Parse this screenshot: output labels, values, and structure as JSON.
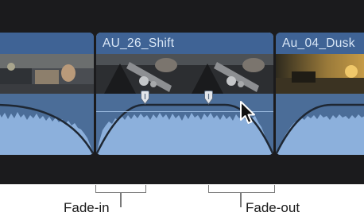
{
  "timeline": {
    "clips": [
      {
        "title": ""
      },
      {
        "title": "AU_26_Shift"
      },
      {
        "title": "Au_04_Dusk"
      }
    ]
  },
  "callouts": {
    "fade_in": "Fade-in",
    "fade_out": "Fade-out"
  },
  "icons": [
    "fade-handle-icon",
    "pointer-cursor-icon"
  ],
  "colors": {
    "timeline_bg": "#1b1b1d",
    "clip_header": "#3f6395",
    "clip_body": "#3d5c83",
    "waveform": "#8cb0dc",
    "volume_line": "#a9c8ec",
    "fade_curve": "#1e2733"
  }
}
